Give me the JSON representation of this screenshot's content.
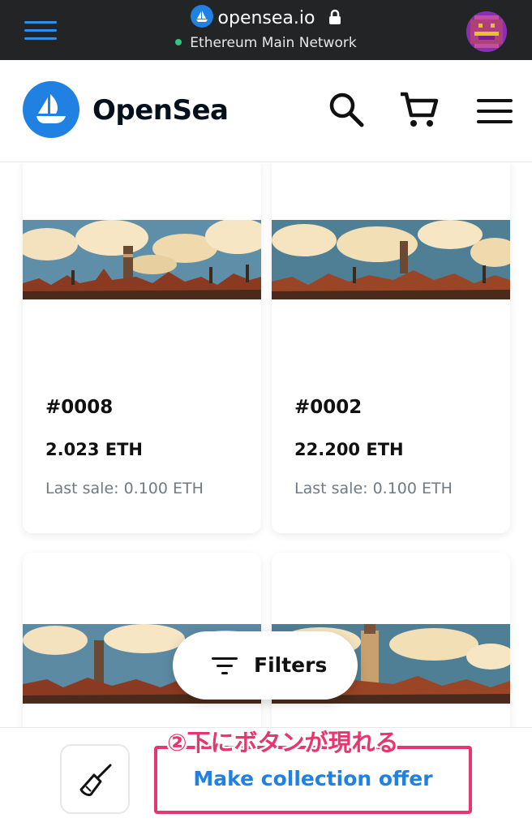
{
  "browser": {
    "url": "opensea.io",
    "network": "Ethereum Main Network"
  },
  "header": {
    "brand": "OpenSea"
  },
  "cards": [
    {
      "title": "#0008",
      "price": "2.023 ETH",
      "last_sale": "Last sale: 0.100 ETH"
    },
    {
      "title": "#0002",
      "price": "22.200 ETH",
      "last_sale": "Last sale: 0.100 ETH"
    }
  ],
  "filters": {
    "label": "Filters"
  },
  "bottom": {
    "offer_label": "Make collection offer",
    "annotation": "②下にボタンが現れる"
  },
  "colors": {
    "accent": "#2081e2",
    "annotation": "#e8356d",
    "network_dot": "#34c77b"
  },
  "icons": [
    "menu-icon",
    "opensea-icon",
    "lock-icon",
    "search-icon",
    "cart-icon",
    "filter-icon",
    "broom-icon"
  ]
}
